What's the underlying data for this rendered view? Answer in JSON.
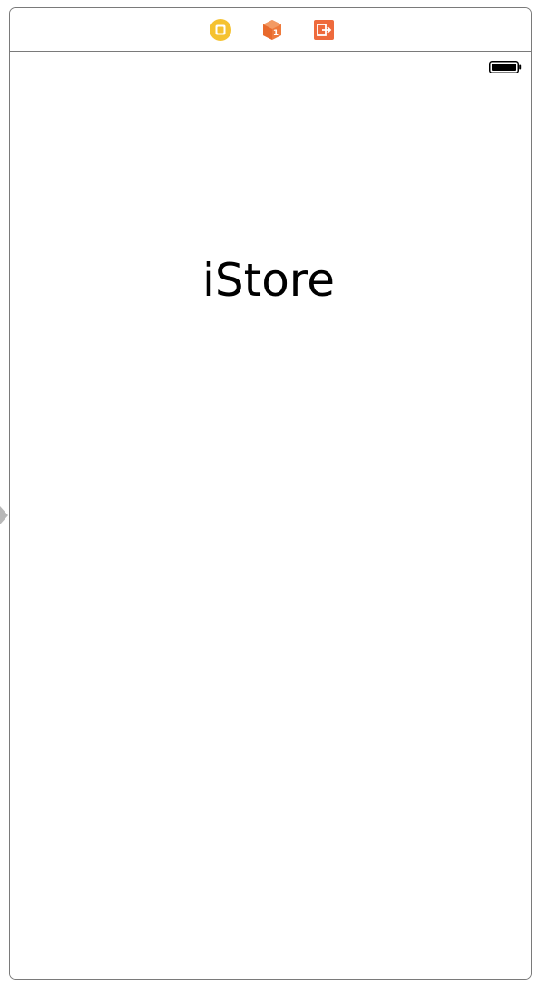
{
  "dock": {
    "items": [
      {
        "name": "view-controller",
        "icon": "view-controller-icon",
        "color": "#F5C230"
      },
      {
        "name": "first-responder",
        "icon": "first-responder-cube-icon",
        "color": "#EE7A3C"
      },
      {
        "name": "exit",
        "icon": "exit-icon",
        "color": "#EE6A3C"
      }
    ]
  },
  "status_bar": {
    "battery_icon": "battery-icon"
  },
  "scene": {
    "title": "iStore"
  },
  "entry_point": {
    "icon": "initial-view-controller-arrow-icon",
    "color": "#B8B8B8"
  }
}
